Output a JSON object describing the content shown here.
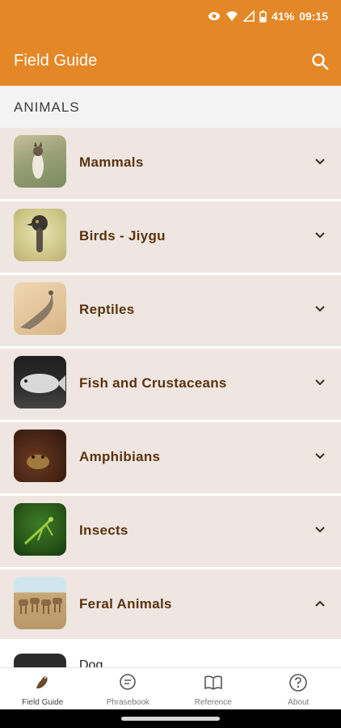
{
  "status": {
    "battery": "41%",
    "time": "09:15"
  },
  "appbar": {
    "title": "Field Guide"
  },
  "section": {
    "title": "ANIMALS"
  },
  "categories": [
    {
      "label": "Mammals",
      "expanded": false
    },
    {
      "label": "Birds - Jiygu",
      "expanded": false
    },
    {
      "label": "Reptiles",
      "expanded": false
    },
    {
      "label": "Fish and Crustaceans",
      "expanded": false
    },
    {
      "label": "Amphibians",
      "expanded": false
    },
    {
      "label": "Insects",
      "expanded": false
    },
    {
      "label": "Feral Animals",
      "expanded": true
    }
  ],
  "subitems": [
    {
      "label": "Dog"
    }
  ],
  "nav": [
    {
      "label": "Field Guide",
      "icon": "bird-icon",
      "active": true
    },
    {
      "label": "Phrasebook",
      "icon": "chat-icon",
      "active": false
    },
    {
      "label": "Reference",
      "icon": "book-icon",
      "active": false
    },
    {
      "label": "About",
      "icon": "help-icon",
      "active": false
    }
  ],
  "colors": {
    "accent": "#e48726",
    "row_bg": "#efe6e1",
    "label": "#5a3310"
  }
}
